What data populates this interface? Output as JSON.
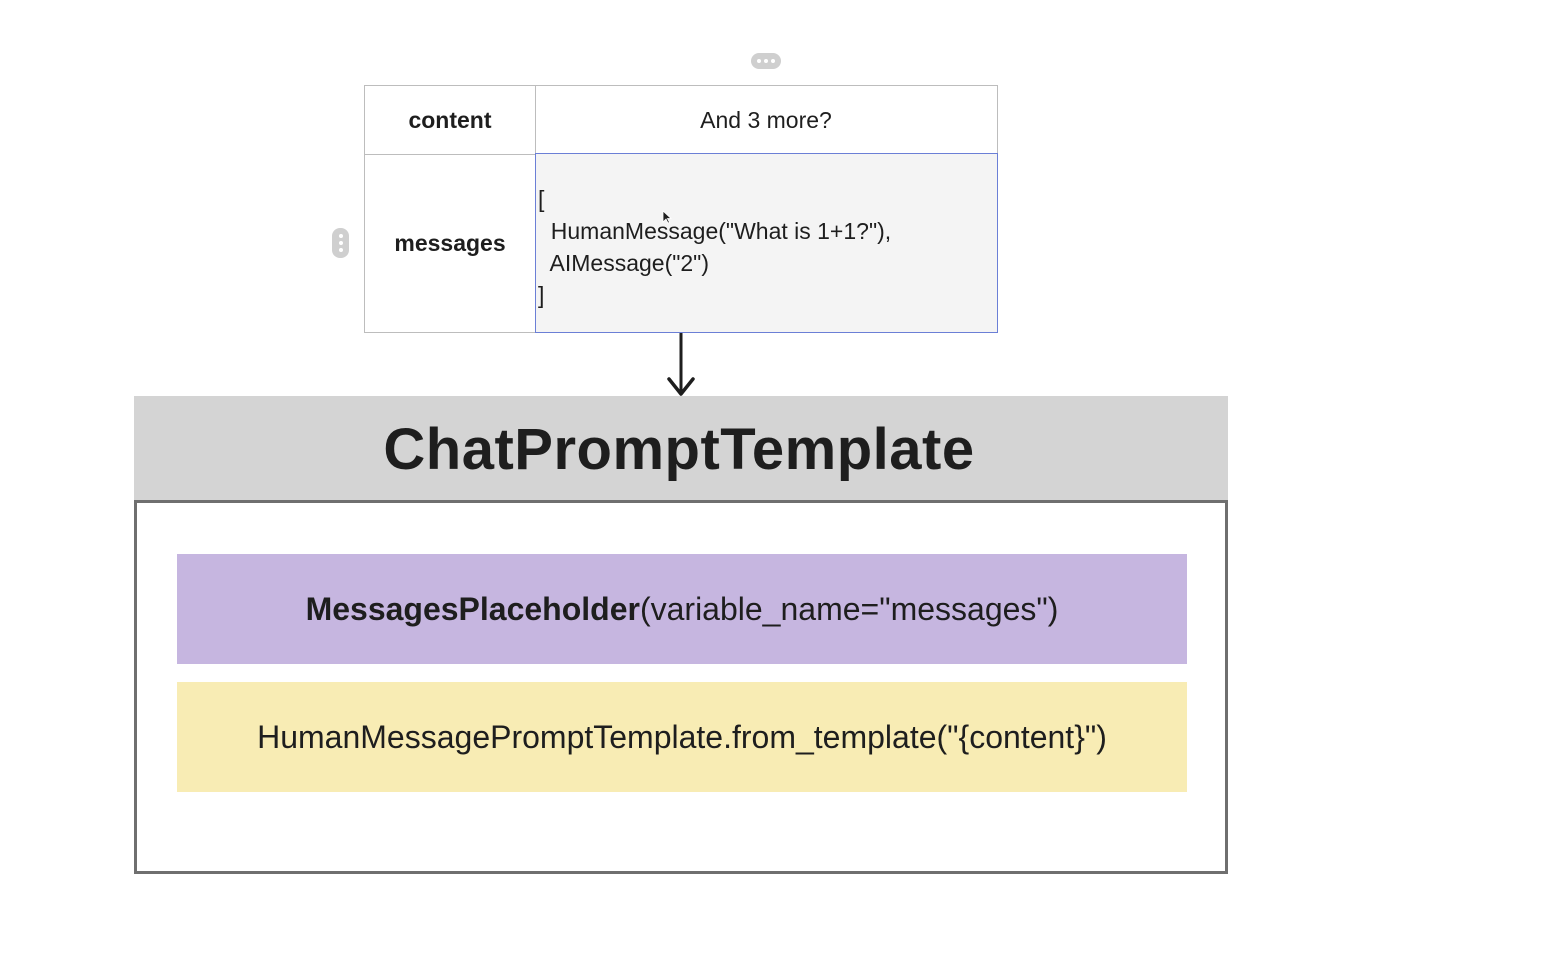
{
  "table": {
    "rows": [
      {
        "key": "content",
        "value": "And 3 more?"
      },
      {
        "key": "messages",
        "value_lines": [
          "[",
          "  HumanMessage(\"What is 1+1?\"),",
          "  AIMessage(\"2\")",
          "]"
        ]
      }
    ]
  },
  "template": {
    "title": "ChatPromptTemplate",
    "placeholder_class": "MessagesPlaceholder",
    "placeholder_args": "(variable_name=\"messages\")",
    "human_template": "HumanMessagePromptTemplate.from_template(\"{content}\")"
  },
  "colors": {
    "header_bg": "#d4d4d4",
    "placeholder_bg": "#c6b6e0",
    "human_bg": "#f8ecb4",
    "selection_border": "#6b7fd6"
  }
}
